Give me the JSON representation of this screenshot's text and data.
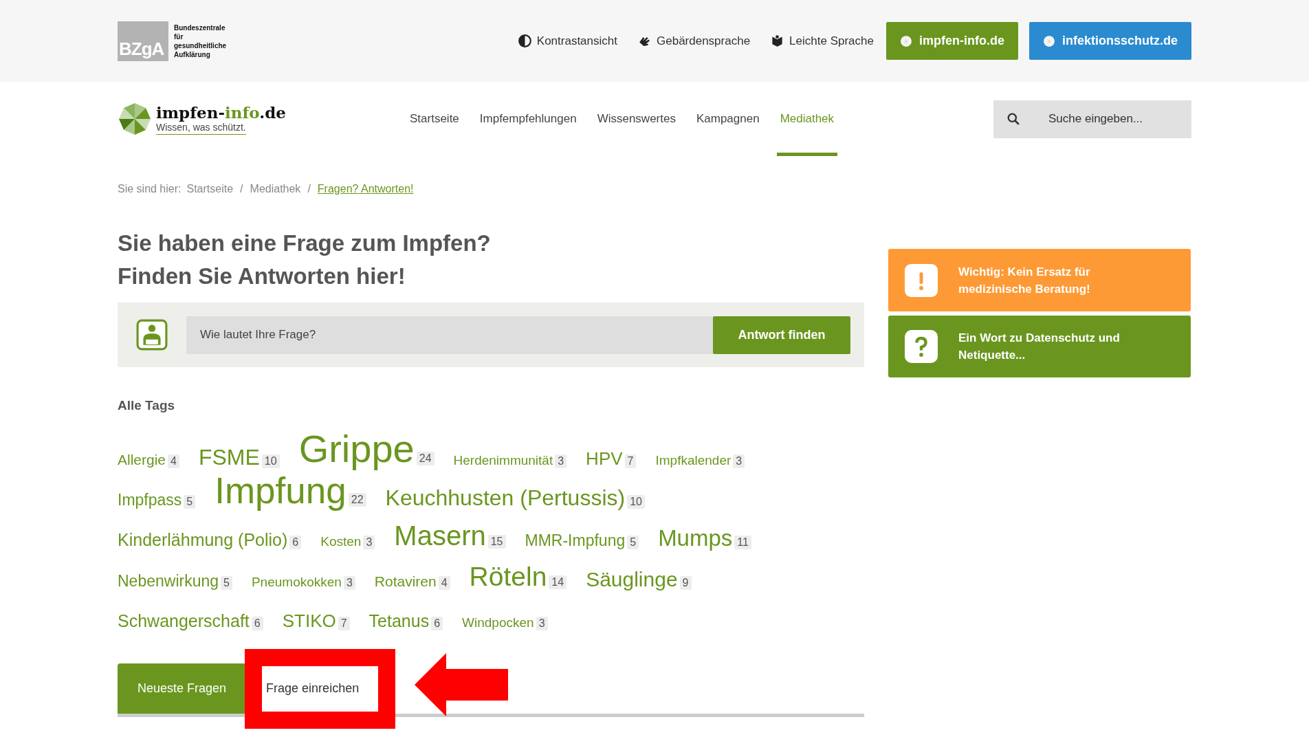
{
  "topbar": {
    "org_logo": {
      "mark": "BZgA",
      "name": "Bundeszentrale für gesundheitliche Aufklärung"
    },
    "links": [
      {
        "kind": "contrast",
        "label": "Kontrastansicht"
      },
      {
        "kind": "sign",
        "label": "Gebärdensprache"
      },
      {
        "kind": "easy",
        "label": "Leichte Sprache"
      }
    ],
    "portals": [
      {
        "label": "impfen-info.de",
        "color": "#6a961f"
      },
      {
        "label": "infektionsschutz.de",
        "color": "#2b8bd0"
      }
    ]
  },
  "header": {
    "logo": {
      "name_start": "impfen-",
      "name_mid": "info",
      "name_end": ".de",
      "tagline": "Wissen, was schützt."
    },
    "nav": [
      {
        "label": "Startseite",
        "selected": false
      },
      {
        "label": "Impfempfehlungen",
        "selected": false
      },
      {
        "label": "Wissenswertes",
        "selected": false
      },
      {
        "label": "Kampagnen",
        "selected": false
      },
      {
        "label": "Mediathek",
        "selected": true
      }
    ],
    "search": {
      "placeholder": "Suche eingeben..."
    }
  },
  "breadcrumb": {
    "prefix": "Sie sind hier:",
    "separator": "/",
    "items": [
      {
        "label": "Startseite",
        "current": false
      },
      {
        "label": "Mediathek",
        "current": false
      },
      {
        "label": "Fragen? Antworten!",
        "current": true
      }
    ]
  },
  "heading": [
    "Sie haben eine Frage zum Impfen?",
    "Finden Sie Antworten hier!"
  ],
  "question": {
    "placeholder": "Wie lautet Ihre Frage?",
    "button": "Antwort finden"
  },
  "tags_title": "Alle Tags",
  "tags": [
    {
      "label": "Allergie",
      "count": "4"
    },
    {
      "label": "FSME",
      "count": "10"
    },
    {
      "label": "Grippe",
      "count": "24"
    },
    {
      "label": "Herdenimmunität",
      "count": "3"
    },
    {
      "label": "HPV",
      "count": "7"
    },
    {
      "label": "Impfkalender",
      "count": "3"
    },
    {
      "label": "Impfpass",
      "count": "5"
    },
    {
      "label": "Impfung",
      "count": "22"
    },
    {
      "label": "Keuchhusten (Pertussis)",
      "count": "10"
    },
    {
      "label": "Kinderlähmung (Polio)",
      "count": "6"
    },
    {
      "label": "Kosten",
      "count": "3"
    },
    {
      "label": "Masern",
      "count": "15"
    },
    {
      "label": "MMR-Impfung",
      "count": "5"
    },
    {
      "label": "Mumps",
      "count": "11"
    },
    {
      "label": "Nebenwirkung",
      "count": "5"
    },
    {
      "label": "Pneumokokken",
      "count": "3"
    },
    {
      "label": "Rotaviren",
      "count": "4"
    },
    {
      "label": "Röteln",
      "count": "14"
    },
    {
      "label": "Säuglinge",
      "count": "9"
    },
    {
      "label": "Schwangerschaft",
      "count": "6"
    },
    {
      "label": "STIKO",
      "count": "7"
    },
    {
      "label": "Tetanus",
      "count": "6"
    },
    {
      "label": "Windpocken",
      "count": "3"
    }
  ],
  "tabs": [
    {
      "label": "Neueste Fragen",
      "selected": true,
      "highlighted": false
    },
    {
      "label": "Frage einreichen",
      "selected": false,
      "highlighted": true
    }
  ],
  "notices": [
    {
      "kind": "warning",
      "text": "Wichtig: Kein Ersatz für medizinische Beratung!",
      "color": "#fe9a35"
    },
    {
      "kind": "question",
      "text": "Ein Wort zu Datenschutz und Netiquette...",
      "color": "#6a961f"
    }
  ]
}
